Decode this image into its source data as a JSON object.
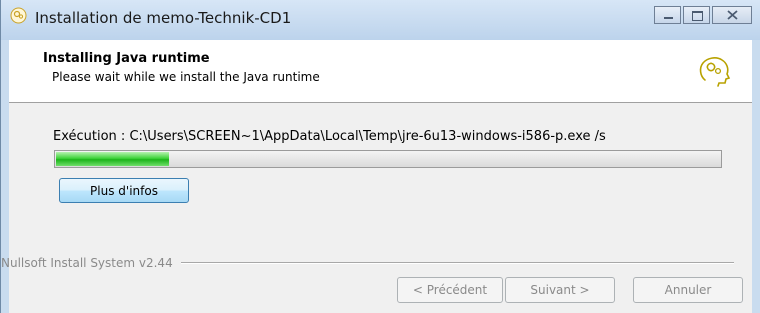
{
  "window": {
    "title": "Installation de memo-Technik-CD1"
  },
  "header": {
    "title": "Installing Java runtime",
    "subtitle": "Please wait while we install the Java runtime"
  },
  "status": {
    "execution_text": "Exécution : C:\\Users\\SCREEN~1\\AppData\\Local\\Temp\\jre-6u13-windows-i586-p.exe /s",
    "progress_fraction": 0.17
  },
  "buttons": {
    "more_info": "Plus d'infos",
    "previous": "< Précédent",
    "next": "Suivant >",
    "cancel": "Annuler"
  },
  "footer": {
    "branding": "Nullsoft Install System v2.44"
  },
  "icons": {
    "title_icon": "installer-gear-head-icon",
    "header_logo": "gear-head-logo-icon",
    "minimize": "minimize-icon",
    "maximize": "maximize-icon",
    "close": "close-icon"
  },
  "colors": {
    "progress_green": "#1db41b",
    "titlebar": "#c9dcef"
  }
}
